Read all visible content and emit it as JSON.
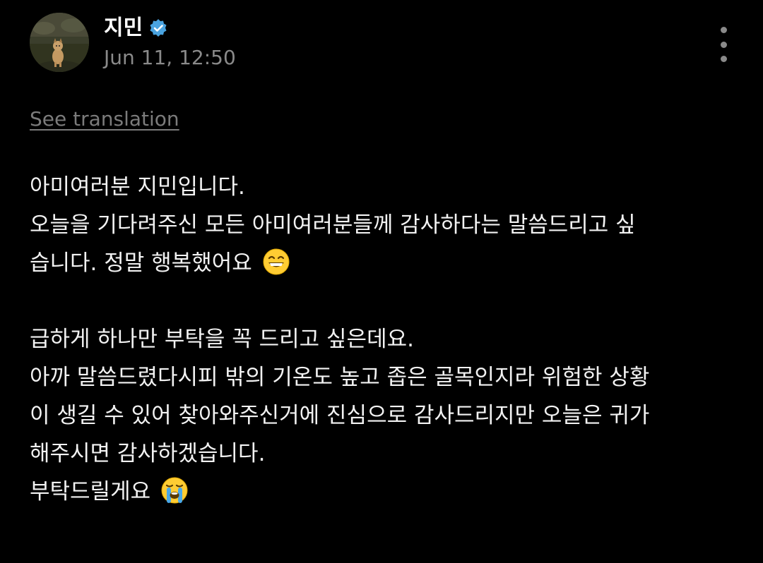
{
  "post": {
    "author": {
      "name": "지민",
      "verified": true,
      "avatar_icon": "dog-photo-avatar"
    },
    "timestamp": "Jun 11, 12:50",
    "more_icon": "vertical-ellipsis-icon",
    "see_translation": "See translation",
    "paragraphs": [
      {
        "lines": [
          "아미여러분 지민입니다.",
          "오늘을 기다려주신 모든 아미여러분들께 감사하다는 말씀드리고 싶",
          "습니다. 정말 행복했어요"
        ],
        "trailing_emoji": "grinning-face-with-smiling-eyes"
      },
      {
        "lines": [
          "급하게 하나만 부탁을 꼭 드리고 싶은데요.",
          "아까 말씀드렸다시피 밖의 기온도 높고 좁은 골목인지라 위험한 상황",
          "이 생길 수 있어 찾아와주신거에 진심으로 감사드리지만 오늘은 귀가",
          "해주시면 감사하겠습니다.",
          "부탁드릴게요"
        ],
        "trailing_emoji": "loudly-crying-face"
      }
    ]
  },
  "colors": {
    "background": "#000000",
    "text": "#f2f2f2",
    "muted": "#8a8a8a",
    "verified_badge": "#4aa3df"
  }
}
